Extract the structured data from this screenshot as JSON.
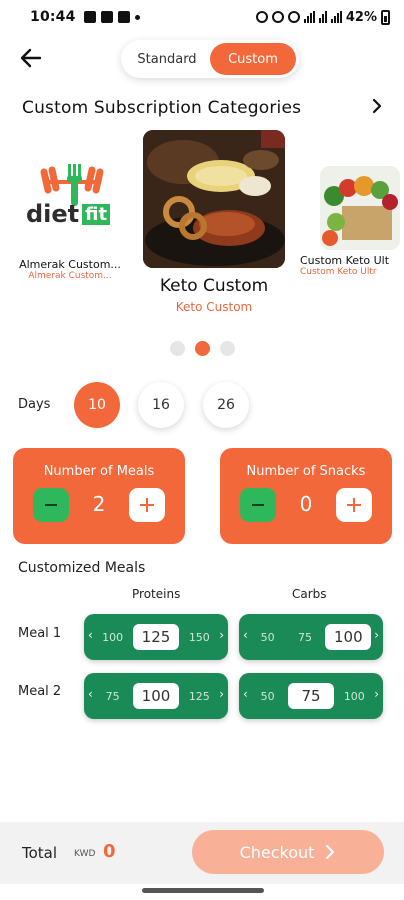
{
  "status_bar": {
    "time": "10:44",
    "battery": "42%"
  },
  "header": {
    "back_icon": "arrow-left-icon",
    "toggle": {
      "options": [
        "Standard",
        "Custom"
      ],
      "selected": "Custom"
    }
  },
  "categories": {
    "title": "Custom Subscription Categories",
    "more_icon": "chevron-right-icon",
    "items": [
      {
        "name": "Almerak Custom...",
        "subtitle": "Almerak Custom...",
        "logo_text": "diet",
        "logo_badge": "fit"
      },
      {
        "name": "Keto Custom",
        "subtitle": "Keto Custom"
      },
      {
        "name": "Custom Keto Ult",
        "subtitle": "Custom Keto Ultr"
      }
    ],
    "active_index": 1,
    "page_count": 3
  },
  "days": {
    "label": "Days",
    "options": [
      "10",
      "16",
      "26"
    ],
    "selected": "10"
  },
  "counters": {
    "meals": {
      "title": "Number of Meals",
      "value": "2"
    },
    "snacks": {
      "title": "Number of Snacks",
      "value": "0"
    }
  },
  "customized_meals": {
    "title": "Customized Meals",
    "columns": [
      "Proteins",
      "Carbs"
    ],
    "rows": [
      {
        "label": "Meal 1",
        "proteins": {
          "prev": "100",
          "selected": "125",
          "next": "150"
        },
        "carbs": {
          "prev": "50",
          "mid": "75",
          "selected": "100"
        }
      },
      {
        "label": "Meal 2",
        "proteins": {
          "prev": "75",
          "selected": "100",
          "next": "125"
        },
        "carbs": {
          "prev": "50",
          "selected": "75",
          "next": "100"
        }
      }
    ]
  },
  "footer": {
    "total_label": "Total",
    "currency": "KWD",
    "total_value": "0",
    "checkout_label": "Checkout"
  },
  "colors": {
    "accent": "#f2683a",
    "green": "#1a8a57",
    "minus_green": "#2fb85b"
  }
}
